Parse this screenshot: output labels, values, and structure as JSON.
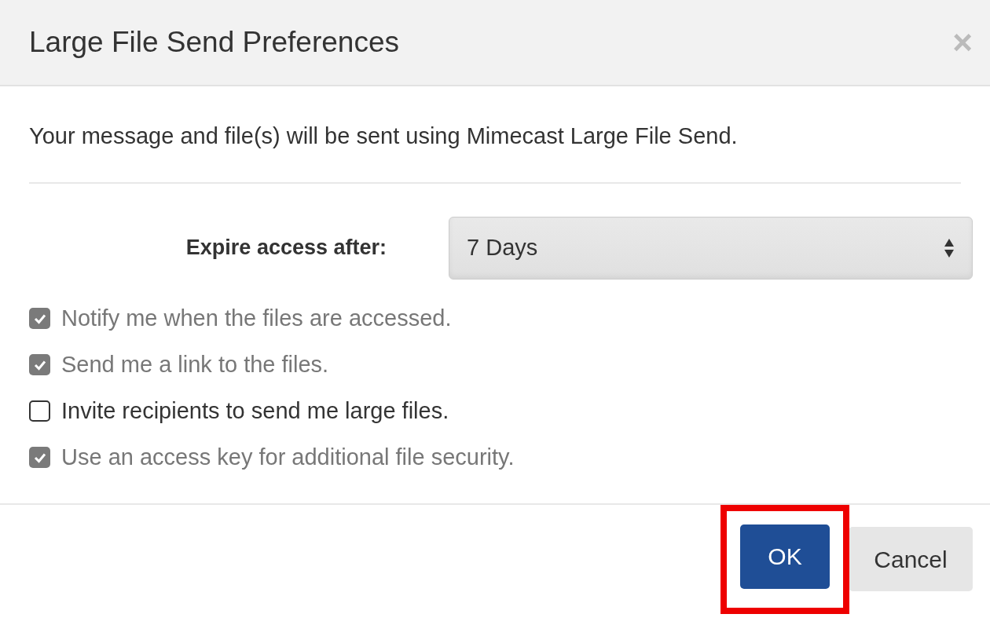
{
  "dialog": {
    "title": "Large File Send Preferences",
    "close": "×"
  },
  "message": "Your message and file(s) will be sent using Mimecast Large File Send.",
  "expire": {
    "label": "Expire access after:",
    "value": "7 Days"
  },
  "options": [
    {
      "label": "Notify me when the files are accessed.",
      "checked": true,
      "disabled": true
    },
    {
      "label": "Send me a link to the files.",
      "checked": true,
      "disabled": true
    },
    {
      "label": "Invite recipients to send me large files.",
      "checked": false,
      "disabled": false
    },
    {
      "label": "Use an access key for additional file security.",
      "checked": true,
      "disabled": true
    }
  ],
  "buttons": [
    {
      "label": "OK",
      "kind": "primary",
      "highlighted": true
    },
    {
      "label": "Cancel",
      "kind": "secondary",
      "highlighted": false
    }
  ]
}
